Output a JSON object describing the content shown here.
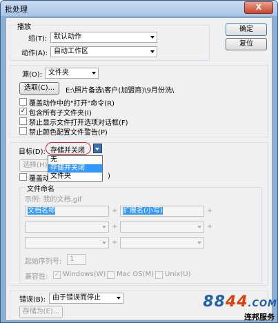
{
  "window": {
    "title": "批处理",
    "close_glyph": "X"
  },
  "play_group": {
    "legend": "播放",
    "set_label": "组(T):",
    "set_value": "默认动作",
    "action_label": "动作(A):",
    "action_value": "自动工作区"
  },
  "side_buttons": {
    "ok": "确定",
    "reset": "复位"
  },
  "source_group": {
    "source_label": "源(O):",
    "source_value": "文件夹",
    "choose_button": "选取(C)...",
    "path": "E:\\照片备选\\客户(加盟商)\\9月份洗\\",
    "checkboxes": [
      {
        "label": "覆盖动作中的\"打开\"命令(R)",
        "checked": false
      },
      {
        "label": "包含所有子文件夹(I)",
        "checked": true
      },
      {
        "label": "禁止显示文件打开选项对话框(F)",
        "checked": false
      },
      {
        "label": "禁止颜色配置文件警告(P)",
        "checked": false
      }
    ]
  },
  "dest_group": {
    "dest_label": "目标(D):",
    "dest_value": "存储并关闭",
    "options": [
      "无",
      "存储并关闭",
      "文件夹"
    ],
    "selected_index": 1,
    "choose_button": "选择(H)...",
    "override_label": "覆盖动作",
    "override_suffix": ")",
    "naming_legend": "文件命名",
    "example": "示例: 我的文档.gif",
    "name_fields": [
      "文档名称",
      "扩展名(小写)",
      "",
      "",
      "",
      ""
    ],
    "plus": "+",
    "serial_label": "起始序列号:",
    "serial_value": "1",
    "compat_label": "兼容性:",
    "compat": [
      {
        "label": "Windows(W)",
        "checked": true
      },
      {
        "label": "Mac OS(M)",
        "checked": false
      },
      {
        "label": "Unix(U)",
        "checked": false
      }
    ]
  },
  "error_group": {
    "error_label": "错误(B):",
    "error_value": "由于错误而停止",
    "save_as_button": "存储为(E)..."
  },
  "watermark": {
    "digits_a": "88",
    "digits_b": "44",
    "suffix": ".COM",
    "caption": "连邦服务"
  }
}
